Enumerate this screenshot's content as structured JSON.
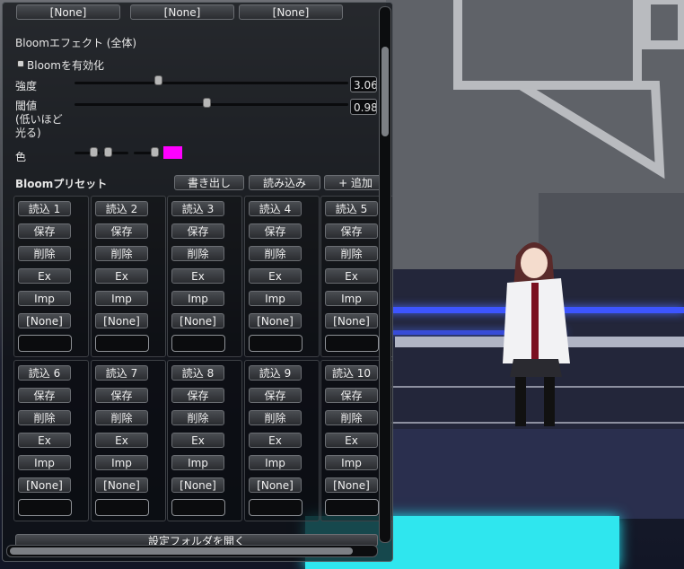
{
  "top_row": [
    "[None]",
    "[None]",
    "[None]"
  ],
  "bloom": {
    "section_title": "Bloomエフェクト (全体)",
    "enable_label": "Bloomを有効化",
    "intensity_label": "強度",
    "intensity_value": "3.06",
    "threshold_label": "閾値\n(低いほど\n光る)",
    "threshold_value": "0.98",
    "color_label": "色",
    "color_swatch": "#ff00ff"
  },
  "preset": {
    "title": "Bloomプリセット",
    "export_label": "書き出し",
    "import_label": "読み込み",
    "add_label": "+ 追加"
  },
  "slots_row1": [
    {
      "load": "読込 1",
      "save": "保存",
      "delete": "削除",
      "ex": "Ex",
      "imp": "Imp",
      "none": "[None]"
    },
    {
      "load": "読込 2",
      "save": "保存",
      "delete": "削除",
      "ex": "Ex",
      "imp": "Imp",
      "none": "[None]"
    },
    {
      "load": "読込 3",
      "save": "保存",
      "delete": "削除",
      "ex": "Ex",
      "imp": "Imp",
      "none": "[None]"
    },
    {
      "load": "読込 4",
      "save": "保存",
      "delete": "削除",
      "ex": "Ex",
      "imp": "Imp",
      "none": "[None]"
    },
    {
      "load": "読込 5",
      "save": "保存",
      "delete": "削除",
      "ex": "Ex",
      "imp": "Imp",
      "none": "[None]"
    }
  ],
  "slots_row2": [
    {
      "load": "読込 6",
      "save": "保存",
      "delete": "削除",
      "ex": "Ex",
      "imp": "Imp",
      "none": "[None]"
    },
    {
      "load": "読込 7",
      "save": "保存",
      "delete": "削除",
      "ex": "Ex",
      "imp": "Imp",
      "none": "[None]"
    },
    {
      "load": "読込 8",
      "save": "保存",
      "delete": "削除",
      "ex": "Ex",
      "imp": "Imp",
      "none": "[None]"
    },
    {
      "load": "読込 9",
      "save": "保存",
      "delete": "削除",
      "ex": "Ex",
      "imp": "Imp",
      "none": "[None]"
    },
    {
      "load": "読込 10",
      "save": "保存",
      "delete": "削除",
      "ex": "Ex",
      "imp": "Imp",
      "none": "[None]"
    }
  ],
  "open_folder_label": "設定フォルダを開く"
}
